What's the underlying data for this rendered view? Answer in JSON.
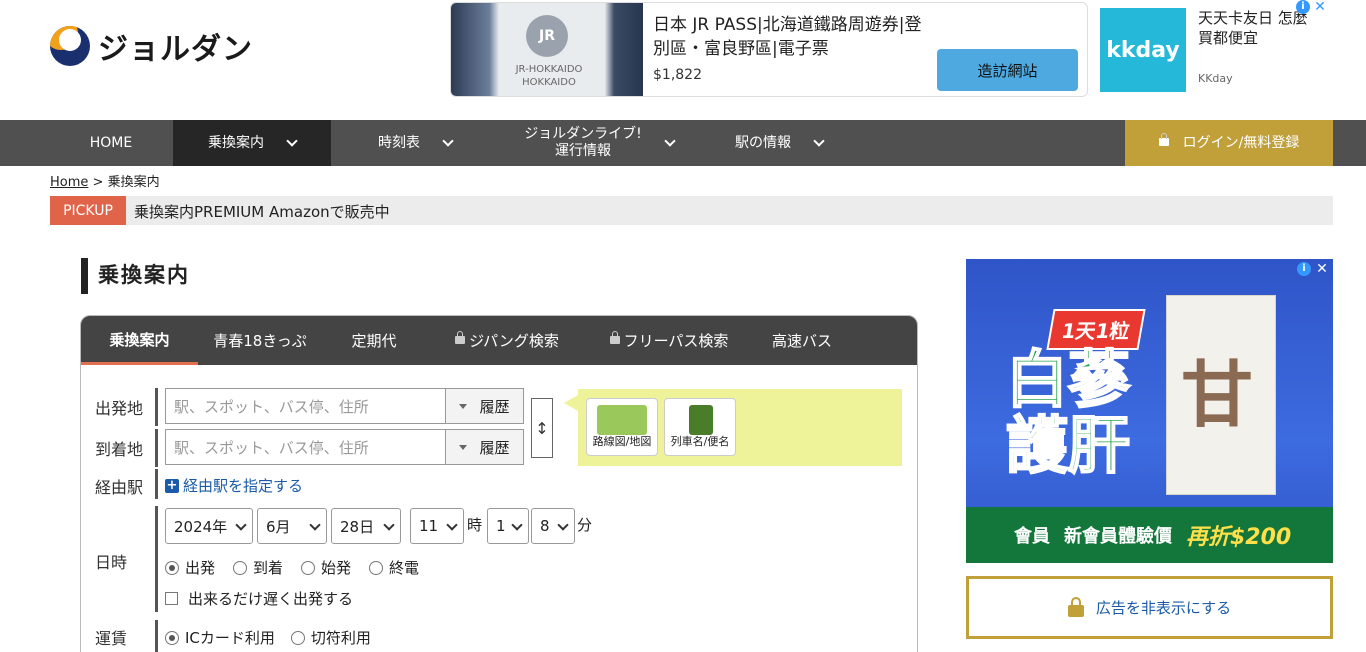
{
  "logo": {
    "name": "ジョルダン"
  },
  "ad_top": {
    "badge": "JR",
    "image_line1": "JR-HOKKAIDO",
    "image_line2": "HOKKAIDO",
    "title": "日本 JR PASS|北海道鐵路周遊券|登別區・富良野區|電子票",
    "price": "$1,822",
    "cta": "造訪網站"
  },
  "ad_top2": {
    "logo": "kkday",
    "title": "天天卡友日 怎麼買都便宜",
    "source": "KKday"
  },
  "nav": {
    "items": [
      {
        "label": "HOME"
      },
      {
        "label": "乗換案内"
      },
      {
        "label": "時刻表"
      },
      {
        "label": "ジョルダンライブ!\n運行情報"
      },
      {
        "label": "駅の情報"
      }
    ],
    "login": "ログイン/無料登録"
  },
  "breadcrumb": {
    "home": "Home",
    "sep": ">",
    "current": "乗換案内"
  },
  "pickup": {
    "badge": "PICKUP",
    "text": "乗換案内PREMIUM Amazonで販売中"
  },
  "page_title": "乗換案内",
  "search": {
    "tabs": [
      "乗換案内",
      "青春18きっぷ",
      "定期代",
      "ジパング検索",
      "フリーパス検索",
      "高速バス"
    ],
    "from_label": "出発地",
    "to_label": "到着地",
    "via_label": "経由駅",
    "datetime_label": "日時",
    "fare_label": "運賃",
    "from_placeholder": "駅、スポット、バス停、住所",
    "to_placeholder": "駅、スポット、バス停、住所",
    "history_label": "履歴",
    "swap_symbol": "↕",
    "map_button": "路線図/地図",
    "train_button": "列車名/便名",
    "via_link": "経由駅を指定する",
    "year": "2024年",
    "month": "6月",
    "day": "28日",
    "hour": "11",
    "hour_unit": "時",
    "minute_tens": "1",
    "minute_ones": "8",
    "minute_unit": "分",
    "time_options": [
      "出発",
      "到着",
      "始発",
      "終電"
    ],
    "late_departure": "出来るだけ遅く出発する",
    "fare_options": [
      "ICカード利用",
      "切符利用"
    ]
  },
  "ad_side": {
    "pill": "1天1粒",
    "headline": "白蔘\n護肝",
    "product_char": "甘",
    "bottom_brand": "會員",
    "bottom_text": "新會員體驗價",
    "bottom_price": "再折$200"
  },
  "hide_ad": "広告を非表示にする"
}
